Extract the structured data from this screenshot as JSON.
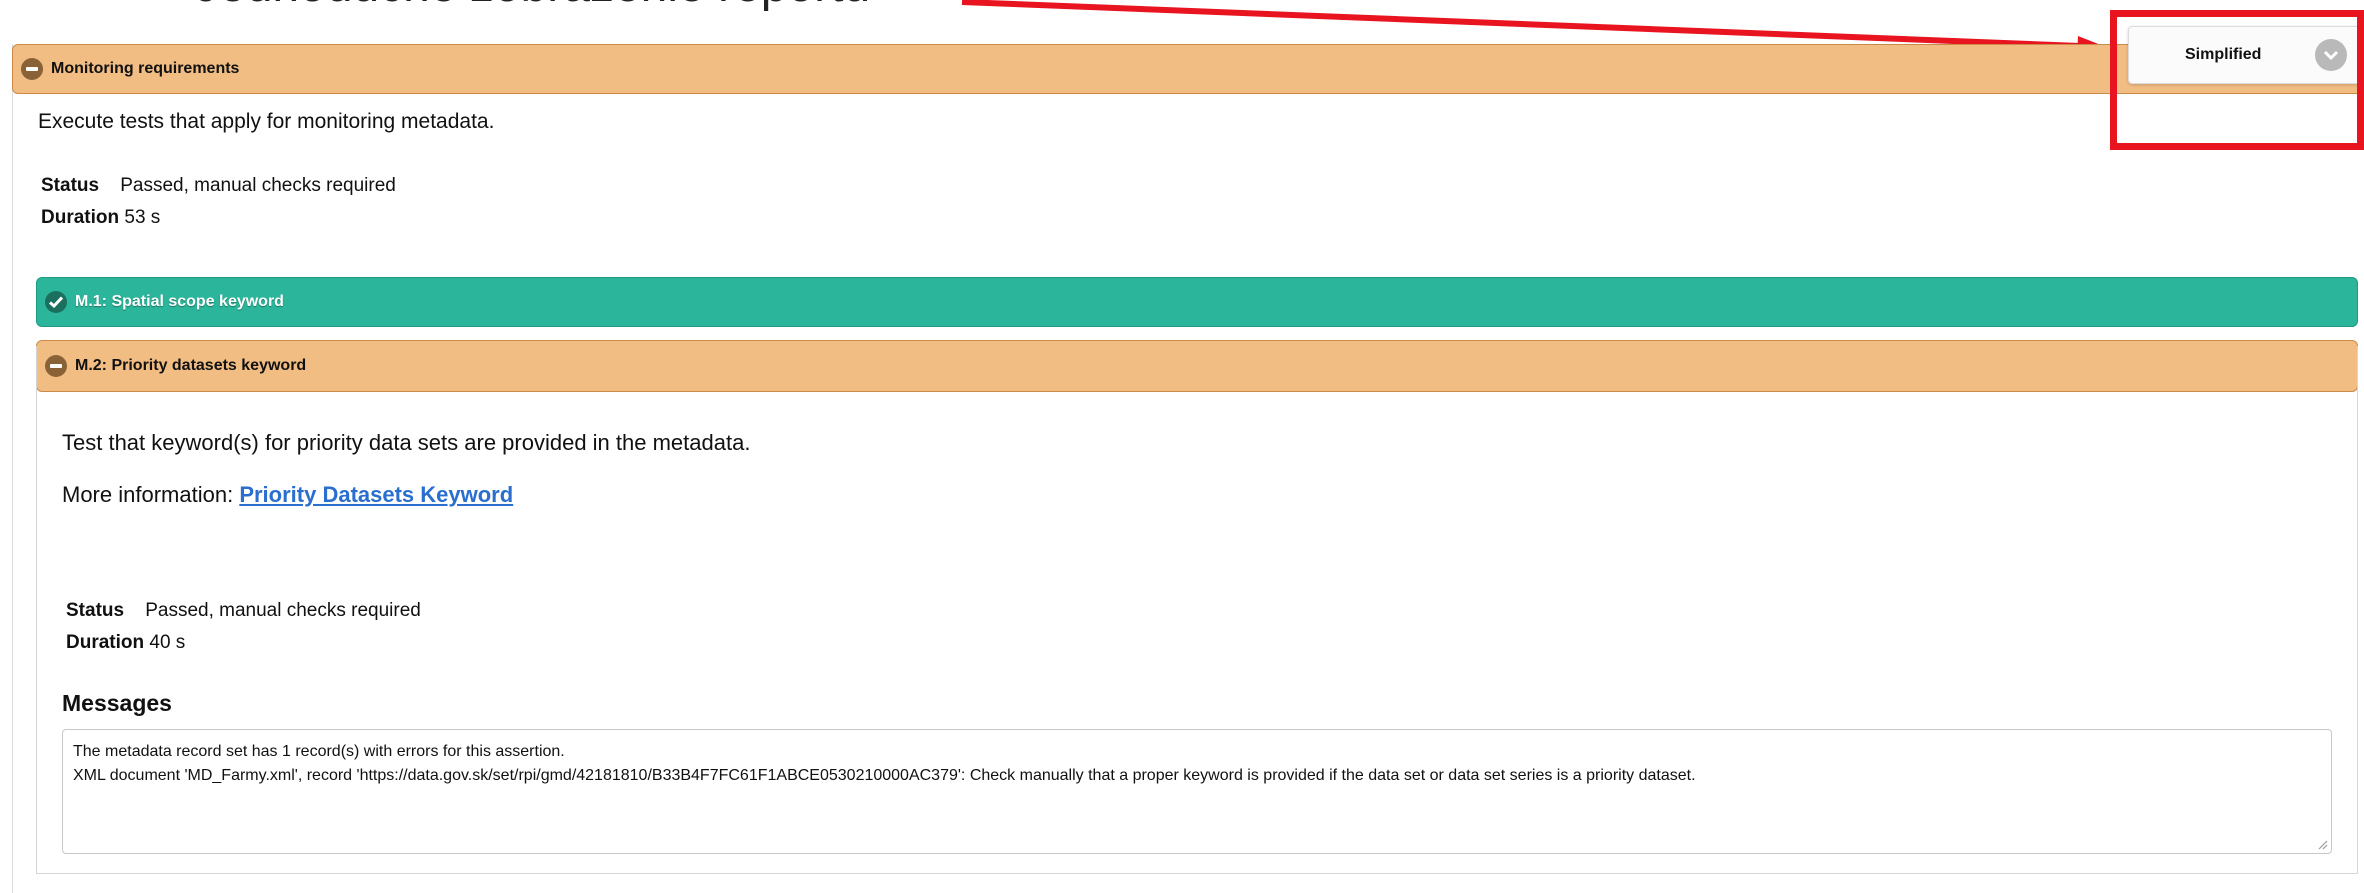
{
  "annotation": {
    "text": "Jednoduché zobrazenie reportu",
    "arrow_color": "#e8141f"
  },
  "view_selector": {
    "selected": "Simplified",
    "icon": "chevron-down-icon"
  },
  "section": {
    "title": "Monitoring requirements",
    "description": "Execute tests that apply for monitoring metadata.",
    "status_label": "Status",
    "status_value": "Passed, manual checks required",
    "duration_label": "Duration",
    "duration_value": "53 s",
    "color": "#f2bd83"
  },
  "tests": [
    {
      "title": "M.1: Spatial scope keyword",
      "state": "passed",
      "icon": "check-icon",
      "color": "#2bb59a"
    },
    {
      "title": "M.2: Priority datasets keyword",
      "state": "manual",
      "icon": "minus-icon",
      "color": "#f2bd83",
      "description": "Test that keyword(s) for priority data sets are provided in the metadata.",
      "more_info_label": "More information:",
      "more_info_link": "Priority Datasets Keyword",
      "status_label": "Status",
      "status_value": "Passed, manual checks required",
      "duration_label": "Duration",
      "duration_value": "40 s",
      "messages_heading": "Messages",
      "messages": [
        "The metadata record set has 1 record(s) with errors for this assertion.",
        "XML document 'MD_Farmy.xml', record 'https://data.gov.sk/set/rpi/gmd/42181810/B33B4F7FC61F1ABCE0530210000AC379': Check manually that a proper keyword is provided if the data set or data set series is a priority dataset."
      ]
    }
  ]
}
